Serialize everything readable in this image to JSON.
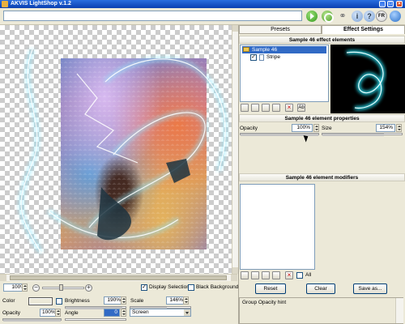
{
  "window": {
    "title": "AKVIS LightShop v.1.2"
  },
  "toolbar": {
    "progress_value": "",
    "lang_label": "FR"
  },
  "tabs": {
    "presets": "Presets",
    "effect_settings": "Effect Settings"
  },
  "elements": {
    "header": "Sample 46 effect elements",
    "tree": [
      {
        "label": "Sample 46",
        "selected": true
      },
      {
        "label": "Stripe",
        "checked": true
      }
    ]
  },
  "properties": {
    "header": "Sample 46 element properties",
    "opacity_label": "Opacity",
    "opacity_value": "100%",
    "size_label": "Size",
    "size_value": "154%"
  },
  "modifiers": {
    "header": "Sample 46 element modifiers",
    "all_label": "All"
  },
  "actions": {
    "reset": "Reset",
    "clear": "Clear",
    "save_as": "Save as..."
  },
  "hint": {
    "text": "Group Opacity hint"
  },
  "canvas_controls": {
    "zoom_value": "100%",
    "display_selection_label": "Display Selection",
    "display_selection_checked": true,
    "black_background_label": "Black Background",
    "black_background_checked": false
  },
  "bottom": {
    "color_label": "Color",
    "brightness_label": "Brightness",
    "brightness_value": "190%",
    "scale_label": "Scale",
    "scale_value": "146%",
    "opacity_label": "Opacity",
    "opacity_value": "100%",
    "angle_label": "Angle",
    "angle_value": "0",
    "blend_mode": "Screen"
  }
}
